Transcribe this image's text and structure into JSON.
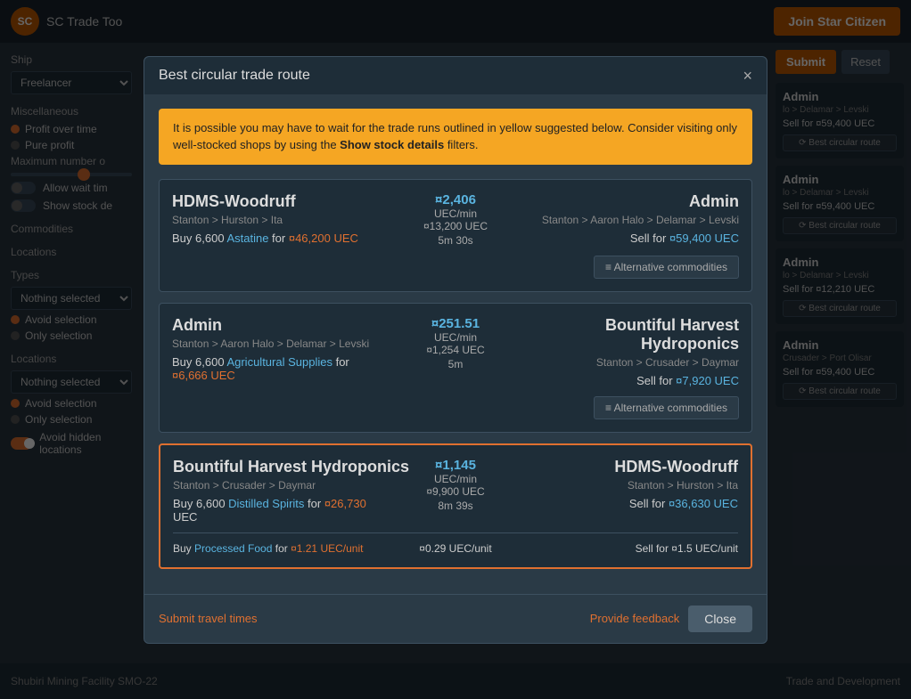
{
  "app": {
    "title": "SC Trade Too",
    "join_btn": "Join Star Citizen"
  },
  "top_right": {
    "submit_label": "Submit",
    "reset_label": "Reset"
  },
  "sidebar": {
    "ship_label": "Ship",
    "ship_value": "Freelancer",
    "misc_label": "Miscellaneous",
    "profit_over_time": "Profit over time",
    "pure_profit": "Pure profit",
    "max_number_label": "Maximum number o",
    "allow_wait": "Allow wait tim",
    "show_stock": "Show stock de",
    "commodities_label": "Commodities",
    "locations_label": "Locations",
    "types_label": "Types",
    "nothing_selected_1": "Nothing selected",
    "avoid_selection_1": "Avoid selection",
    "only_selection_1": "Only selection",
    "locations_label2": "Locations",
    "nothing_selected_2": "Nothing selected",
    "avoid_selection_2": "Avoid selection",
    "only_selection_2": "Only selection",
    "avoid_hidden": "Avoid hidden locations"
  },
  "right_cards": [
    {
      "title": "Admin",
      "route": "lo > Delamar > Levski",
      "sell_label": "Sell for",
      "sell_symbol": "¤",
      "sell_price": "59,400",
      "sell_unit": "UEC",
      "btn_label": "⟳ Best circular route"
    },
    {
      "title": "Admin",
      "route": "lo > Delamar > Levski",
      "sell_label": "Sell for",
      "sell_symbol": "¤",
      "sell_price": "59,400",
      "sell_unit": "UEC",
      "btn_label": "⟳ Best circular route"
    },
    {
      "title": "Admin",
      "route": "lo > Delamar > Levski",
      "sell_label": "Sell for",
      "sell_symbol": "¤",
      "sell_price": "12,210",
      "sell_unit": "UEC",
      "btn_label": "⟳ Best circular route"
    },
    {
      "title": "Admin",
      "route": "Crusader > Port Olisar",
      "sell_label": "Sell for",
      "sell_symbol": "¤",
      "sell_price": "59,400",
      "sell_unit": "UEC",
      "btn_label": "⟳ Best circular route"
    }
  ],
  "bottom_bar": {
    "location": "Shubiri Mining Facility SMO-22",
    "right_text": "Trade and Development"
  },
  "modal": {
    "title": "Best circular trade route",
    "close_label": "×",
    "warning": {
      "text": "It is possible you may have to wait for the trade runs outlined in yellow suggested below. Consider visiting only well-stocked shops by using the ",
      "link_text": "Show stock details",
      "text2": " filters."
    },
    "cards": [
      {
        "from_location": "HDMS-Woodruff",
        "from_route": "Stanton > Hurston > Ita",
        "buy_quantity": "6,600",
        "buy_commodity": "Astatine",
        "buy_price_symbol": "¤",
        "buy_price": "46,200",
        "buy_unit": "UEC",
        "profit_symbol": "¤",
        "profit_value": "2,406",
        "profit_unit": "UEC/min",
        "total_symbol": "¤",
        "total_value": "13,200",
        "total_unit": "UEC",
        "time": "5m 30s",
        "to_location": "Admin",
        "to_route": "Stanton > Aaron Halo > Delamar > Levski",
        "sell_label": "Sell for",
        "sell_symbol": "¤",
        "sell_price": "59,400",
        "sell_unit": "UEC",
        "alt_btn": "≡ Alternative commodities",
        "highlighted": false
      },
      {
        "from_location": "Admin",
        "from_route": "Stanton > Aaron Halo > Delamar > Levski",
        "buy_quantity": "6,600",
        "buy_commodity": "Agricultural Supplies",
        "buy_price_symbol": "¤",
        "buy_price": "6,666",
        "buy_unit": "UEC",
        "profit_symbol": "¤",
        "profit_value": "251.51",
        "profit_unit": "UEC/min",
        "total_symbol": "¤",
        "total_value": "1,254",
        "total_unit": "UEC",
        "time": "5m",
        "to_location": "Bountiful Harvest Hydroponics",
        "to_route": "Stanton > Crusader > Daymar",
        "sell_label": "Sell for",
        "sell_symbol": "¤",
        "sell_price": "7,920",
        "sell_unit": "UEC",
        "alt_btn": "≡ Alternative commodities",
        "highlighted": false
      },
      {
        "from_location": "Bountiful Harvest Hydroponics",
        "from_route": "Stanton > Crusader > Daymar",
        "buy_quantity": "6,600",
        "buy_commodity": "Distilled Spirits",
        "buy_price_symbol": "¤",
        "buy_price": "26,730",
        "buy_unit": "UEC",
        "profit_symbol": "¤",
        "profit_value": "1,145",
        "profit_unit": "UEC/min",
        "total_symbol": "¤",
        "total_value": "9,900",
        "total_unit": "UEC",
        "time": "8m 39s",
        "to_location": "HDMS-Woodruff",
        "to_route": "Stanton > Hurston > Ita",
        "sell_label": "Sell for",
        "sell_symbol": "¤",
        "sell_price": "36,630",
        "sell_unit": "UEC",
        "alt_btn": "",
        "highlighted": true,
        "sub_row": {
          "buy_label": "Buy",
          "buy_commodity": "Processed Food",
          "buy_price_symbol": "¤",
          "buy_price": "1.21",
          "buy_unit": "UEC/unit",
          "center_symbol": "¤",
          "center_value": "0.29",
          "center_unit": "UEC/unit",
          "sell_label": "Sell for",
          "sell_symbol": "¤",
          "sell_price": "1.5",
          "sell_unit": "UEC/unit"
        }
      }
    ],
    "submit_travel_label": "Submit travel times",
    "provide_feedback_label": "Provide feedback",
    "close_btn_label": "Close"
  }
}
